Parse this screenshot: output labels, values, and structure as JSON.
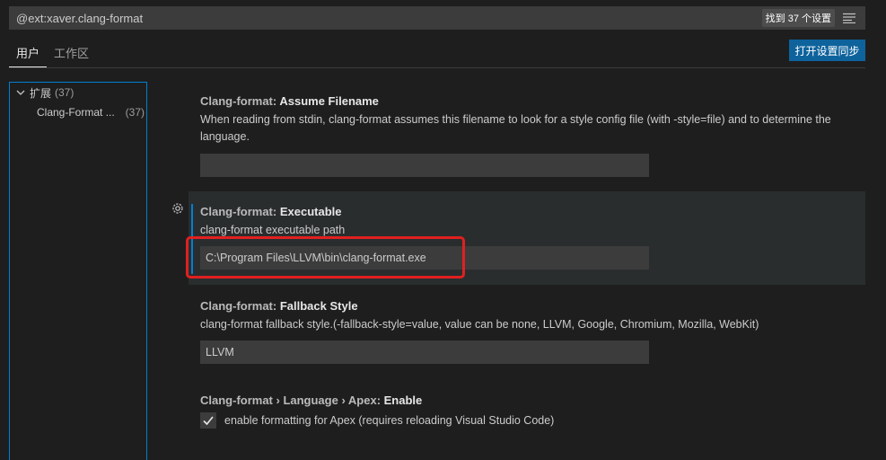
{
  "search": {
    "value": "@ext:xaver.clang-format",
    "result_count": "找到 37 个设置"
  },
  "tabs": [
    {
      "label": "用户",
      "active": true
    },
    {
      "label": "工作区",
      "active": false
    }
  ],
  "sync_button": "打开设置同步",
  "toc": {
    "group": {
      "label": "扩展",
      "count": "(37)"
    },
    "child": {
      "label": "Clang-Format ...",
      "count": "(37)"
    }
  },
  "settings": [
    {
      "category": "Clang-format: ",
      "name": "Assume Filename",
      "description": "When reading from stdin, clang-format assumes this filename to look for a style config file (with -style=file) and to determine the language.",
      "value": ""
    },
    {
      "category": "Clang-format: ",
      "name": "Executable",
      "description": "clang-format executable path",
      "value": "C:\\Program Files\\LLVM\\bin\\clang-format.exe"
    },
    {
      "category": "Clang-format: ",
      "name": "Fallback Style",
      "description": "clang-format fallback style.(-fallback-style=value, value can be none, LLVM, Google, Chromium, Mozilla, WebKit)",
      "value": "LLVM"
    },
    {
      "category": "Clang-format › Language › Apex: ",
      "name": "Enable",
      "description": "enable formatting for Apex (requires reloading Visual Studio Code)",
      "checked": true
    }
  ],
  "colors": {
    "accent": "#007fd4",
    "button": "#0e639c",
    "highlight": "#e02020"
  }
}
